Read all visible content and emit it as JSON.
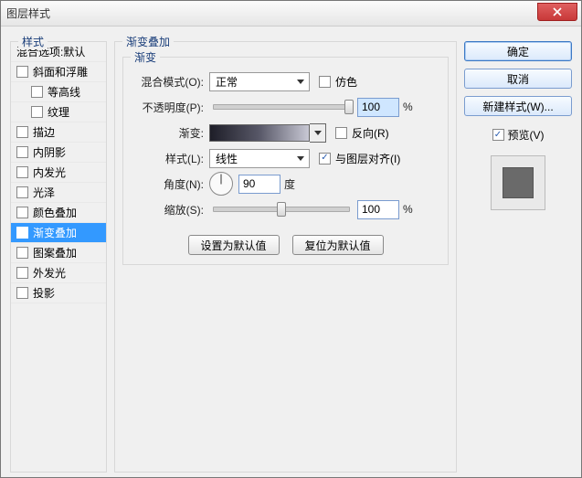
{
  "window": {
    "title": "图层样式"
  },
  "left": {
    "legend": "样式",
    "items": [
      {
        "label": "混合选项:默认",
        "checked": null,
        "indent": false,
        "selected": false
      },
      {
        "label": "斜面和浮雕",
        "checked": false,
        "indent": false,
        "selected": false
      },
      {
        "label": "等高线",
        "checked": false,
        "indent": true,
        "selected": false
      },
      {
        "label": "纹理",
        "checked": false,
        "indent": true,
        "selected": false
      },
      {
        "label": "描边",
        "checked": false,
        "indent": false,
        "selected": false
      },
      {
        "label": "内阴影",
        "checked": false,
        "indent": false,
        "selected": false
      },
      {
        "label": "内发光",
        "checked": false,
        "indent": false,
        "selected": false
      },
      {
        "label": "光泽",
        "checked": false,
        "indent": false,
        "selected": false
      },
      {
        "label": "颜色叠加",
        "checked": false,
        "indent": false,
        "selected": false
      },
      {
        "label": "渐变叠加",
        "checked": true,
        "indent": false,
        "selected": true
      },
      {
        "label": "图案叠加",
        "checked": false,
        "indent": false,
        "selected": false
      },
      {
        "label": "外发光",
        "checked": false,
        "indent": false,
        "selected": false
      },
      {
        "label": "投影",
        "checked": false,
        "indent": false,
        "selected": false
      }
    ]
  },
  "mid": {
    "legend": "渐变叠加",
    "inner_legend": "渐变",
    "blend_label": "混合模式(O):",
    "blend_value": "正常",
    "dither_label": "仿色",
    "opacity_label": "不透明度(P):",
    "opacity_value": "100",
    "gradient_label": "渐变:",
    "reverse_label": "反向(R)",
    "style_label": "样式(L):",
    "style_value": "线性",
    "align_label": "与图层对齐(I)",
    "angle_label": "角度(N):",
    "angle_value": "90",
    "angle_unit": "度",
    "scale_label": "缩放(S):",
    "scale_value": "100",
    "percent": "%",
    "btn_default": "设置为默认值",
    "btn_reset": "复位为默认值"
  },
  "right": {
    "ok": "确定",
    "cancel": "取消",
    "new_style": "新建样式(W)...",
    "preview_label": "预览(V)"
  }
}
